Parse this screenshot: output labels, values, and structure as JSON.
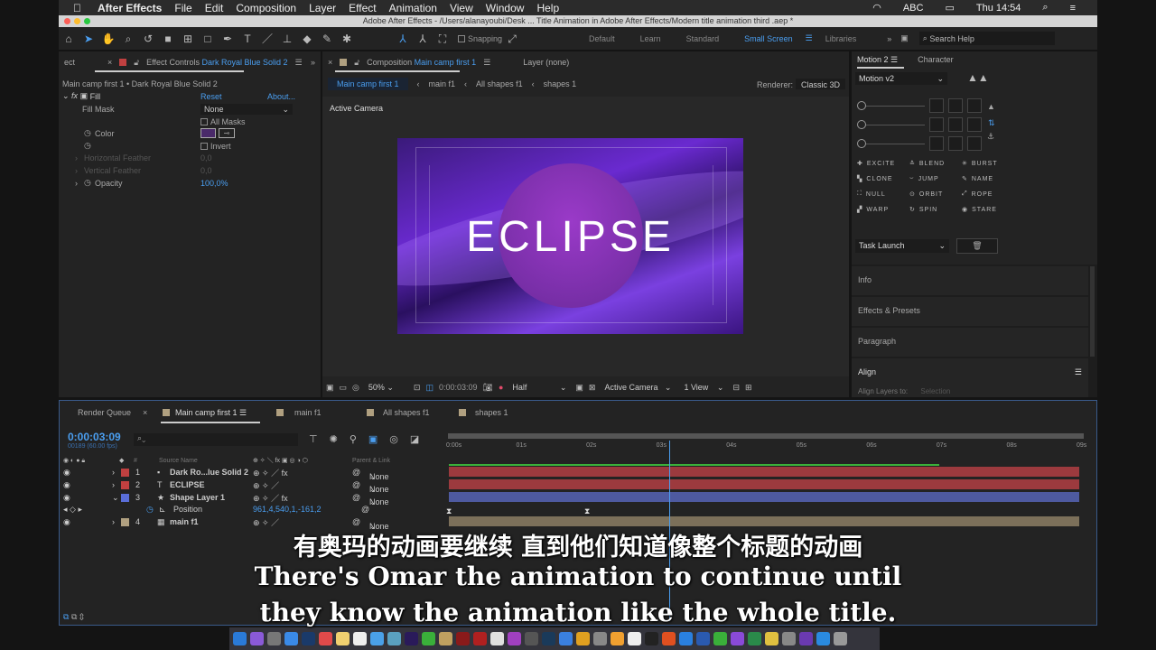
{
  "menubar": {
    "app": "After Effects",
    "items": [
      "File",
      "Edit",
      "Composition",
      "Layer",
      "Effect",
      "Animation",
      "View",
      "Window",
      "Help"
    ],
    "input_source": "ABC",
    "clock": "Thu 14:54"
  },
  "window": {
    "title": "Adobe After Effects - /Users/alanayoubi/Desk ...  Title Animation in Adobe After Effects/Modern title animation third .aep *"
  },
  "toolbar": {
    "snapping": "Snapping",
    "workspaces": [
      "Default",
      "Learn",
      "Standard",
      "Small Screen",
      "Libraries"
    ],
    "active_workspace": "Small Screen",
    "search_placeholder": "Search Help"
  },
  "effect_controls": {
    "partial_tab": "ect",
    "tab_prefix": "Effect Controls",
    "tab_layer": "Dark Royal Blue Solid 2",
    "breadcrumb": "Main camp first 1 • Dark Royal Blue Solid 2",
    "effect": "Fill",
    "reset": "Reset",
    "about": "About...",
    "fill_mask_label": "Fill Mask",
    "fill_mask_value": "None",
    "all_masks": "All Masks",
    "color_label": "Color",
    "color_value": "#4a2a6a",
    "invert": "Invert",
    "h_feather_label": "Horizontal Feather",
    "h_feather_value": "0,0",
    "v_feather_label": "Vertical Feather",
    "v_feather_value": "0,0",
    "opacity_label": "Opacity",
    "opacity_value": "100,0%"
  },
  "composition": {
    "tab_prefix": "Composition",
    "tab_name": "Main camp first 1",
    "layer_tab": "Layer (none)",
    "crumbs": [
      "Main camp first 1",
      "main f1",
      "All shapes f1",
      "shapes 1"
    ],
    "renderer_label": "Renderer:",
    "renderer": "Classic 3D",
    "camera_label": "Active Camera",
    "title_text": "ECLIPSE",
    "zoom": "50%",
    "timecode": "0:00:03:09",
    "resolution": "Half",
    "view_camera": "Active Camera",
    "views": "1 View"
  },
  "right_panel": {
    "tabs": [
      "Motion 2",
      "Character"
    ],
    "motion_version": "Motion v2",
    "buttons": [
      "EXCITE",
      "BLEND",
      "BURST",
      "CLONE",
      "JUMP",
      "NAME",
      "NULL",
      "ORBIT",
      "ROPE",
      "WARP",
      "SPIN",
      "STARE"
    ],
    "task": "Task Launch",
    "sections": [
      "Info",
      "Effects & Presets",
      "Paragraph",
      "Align"
    ],
    "align_label": "Align Layers to:",
    "align_value": "Selection"
  },
  "timeline": {
    "tabs": [
      "Render Queue",
      "Main camp first 1",
      "main f1",
      "All shapes f1",
      "shapes 1"
    ],
    "active_tab": "Main camp first 1",
    "timecode": "0:00:03:09",
    "frame_info": "00189 (60.00 fps)",
    "columns": {
      "source": "Source Name",
      "parent": "Parent & Link"
    },
    "ruler": [
      "0:00s",
      "01s",
      "02s",
      "03s",
      "04s",
      "05s",
      "06s",
      "07s",
      "08s",
      "09s"
    ],
    "current_time_s": 3.15,
    "layers": [
      {
        "num": "1",
        "name": "Dark Ro...lue Solid 2",
        "color": "#c04040",
        "parent": "None",
        "bar": "#9c3a3e"
      },
      {
        "num": "2",
        "name": "ECLIPSE",
        "color": "#c04040",
        "parent": "None",
        "bar": "#9c3a3e"
      },
      {
        "num": "3",
        "name": "Shape Layer 1",
        "color": "#5a6ed8",
        "parent": "None",
        "bar": "#4e5aa0"
      },
      {
        "num": "4",
        "name": "main f1",
        "color": "#b0a080",
        "parent": "None",
        "bar": "#7c705a"
      }
    ],
    "property": {
      "name": "Position",
      "value": "961,4,540,1,-161,2"
    }
  },
  "subtitles": {
    "zh": "有奥玛的动画要继续 直到他们知道像整个标题的动画",
    "en1": "There's Omar the animation to continue until",
    "en2": "they know the animation like the whole title."
  }
}
